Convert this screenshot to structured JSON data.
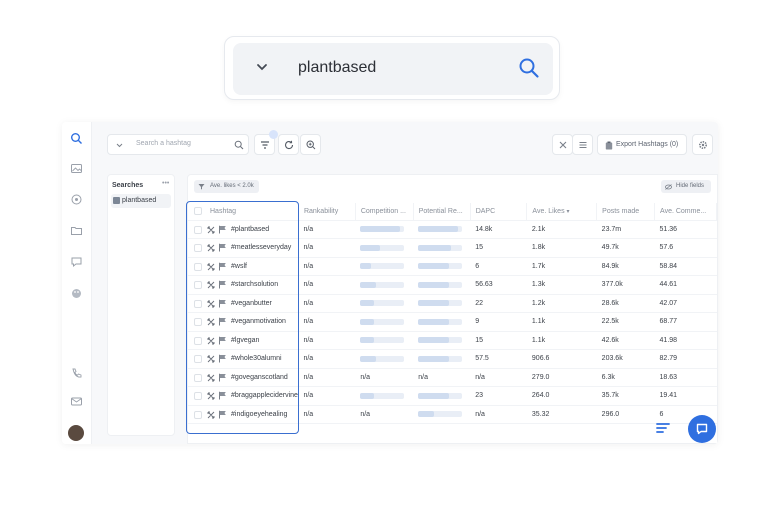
{
  "big_search": {
    "value": "plantbased",
    "chevron_icon": "chevron-down-icon",
    "search_icon": "search-icon",
    "accent": "#2f6fe0"
  },
  "rail": {
    "icons": [
      "search-icon",
      "image-icon",
      "target-icon",
      "folder-icon",
      "chat-icon",
      "palette-icon",
      "phone-icon",
      "message-icon"
    ]
  },
  "toolbar": {
    "search_placeholder": "Search a hashtag",
    "export_label": "Export Hashtags (0)"
  },
  "searches_panel": {
    "title": "Searches",
    "more": "•••",
    "items": [
      "plantbased"
    ]
  },
  "filters": {
    "chip_label": "Ave. likes < 2.0k",
    "hide_fields_label": "Hide fields"
  },
  "table": {
    "headers": [
      "Hashtag",
      "Rankability",
      "Competition ...",
      "Potential Re...",
      "DAPC",
      "Ave. Likes",
      "Posts made",
      "Ave. Comme..."
    ],
    "rows": [
      {
        "hashtag": "#plantbased",
        "rankability": "n/a",
        "competition": "",
        "competition_level": 0.9,
        "potential": "",
        "potential_level": 0.9,
        "dapc": "14.8k",
        "ave_likes": "2.1k",
        "posts_made": "23.7m",
        "ave_comments": "51.36"
      },
      {
        "hashtag": "#meatlesseveryday",
        "rankability": "n/a",
        "competition": "",
        "competition_level": 0.45,
        "potential": "",
        "potential_level": 0.75,
        "dapc": "15",
        "ave_likes": "1.8k",
        "posts_made": "49.7k",
        "ave_comments": "57.6"
      },
      {
        "hashtag": "#wslf",
        "rankability": "n/a",
        "competition": "",
        "competition_level": 0.25,
        "potential": "",
        "potential_level": 0.7,
        "dapc": "6",
        "ave_likes": "1.7k",
        "posts_made": "84.9k",
        "ave_comments": "58.84"
      },
      {
        "hashtag": "#starchsolution",
        "rankability": "n/a",
        "competition": "",
        "competition_level": 0.35,
        "potential": "",
        "potential_level": 0.7,
        "dapc": "56.63",
        "ave_likes": "1.3k",
        "posts_made": "377.0k",
        "ave_comments": "44.61"
      },
      {
        "hashtag": "#veganbutter",
        "rankability": "n/a",
        "competition": "",
        "competition_level": 0.3,
        "potential": "",
        "potential_level": 0.7,
        "dapc": "22",
        "ave_likes": "1.2k",
        "posts_made": "28.6k",
        "ave_comments": "42.07"
      },
      {
        "hashtag": "#veganmotivation",
        "rankability": "n/a",
        "competition": "",
        "competition_level": 0.3,
        "potential": "",
        "potential_level": 0.7,
        "dapc": "9",
        "ave_likes": "1.1k",
        "posts_made": "22.5k",
        "ave_comments": "68.77"
      },
      {
        "hashtag": "#lgvegan",
        "rankability": "n/a",
        "competition": "",
        "competition_level": 0.3,
        "potential": "",
        "potential_level": 0.7,
        "dapc": "15",
        "ave_likes": "1.1k",
        "posts_made": "42.6k",
        "ave_comments": "41.98"
      },
      {
        "hashtag": "#whole30alumni",
        "rankability": "n/a",
        "competition": "",
        "competition_level": 0.35,
        "potential": "",
        "potential_level": 0.7,
        "dapc": "57.5",
        "ave_likes": "906.6",
        "posts_made": "203.6k",
        "ave_comments": "82.79"
      },
      {
        "hashtag": "#goveganscotland",
        "rankability": "n/a",
        "competition": "n/a",
        "competition_level": null,
        "potential": "n/a",
        "potential_level": null,
        "dapc": "n/a",
        "ave_likes": "279.0",
        "posts_made": "6.3k",
        "ave_comments": "18.63"
      },
      {
        "hashtag": "#braggapplecidervinega",
        "rankability": "n/a",
        "competition": "",
        "competition_level": 0.3,
        "potential": "",
        "potential_level": 0.7,
        "dapc": "23",
        "ave_likes": "264.0",
        "posts_made": "35.7k",
        "ave_comments": "19.41"
      },
      {
        "hashtag": "#indigoeyehealing",
        "rankability": "n/a",
        "competition": "n/a",
        "competition_level": null,
        "potential": "",
        "potential_level": 0.35,
        "dapc": "n/a",
        "ave_likes": "35.32",
        "posts_made": "296.0",
        "ave_comments": "6"
      }
    ]
  },
  "colors": {
    "accent": "#2f6fe0",
    "highlight_border": "#3a6fd0",
    "bar_fill": "#cfdcef",
    "bar_track": "#e9eef6"
  },
  "floating": {
    "menu_icon": "filter-lines-icon",
    "chat_icon": "chat-bubble-icon"
  }
}
